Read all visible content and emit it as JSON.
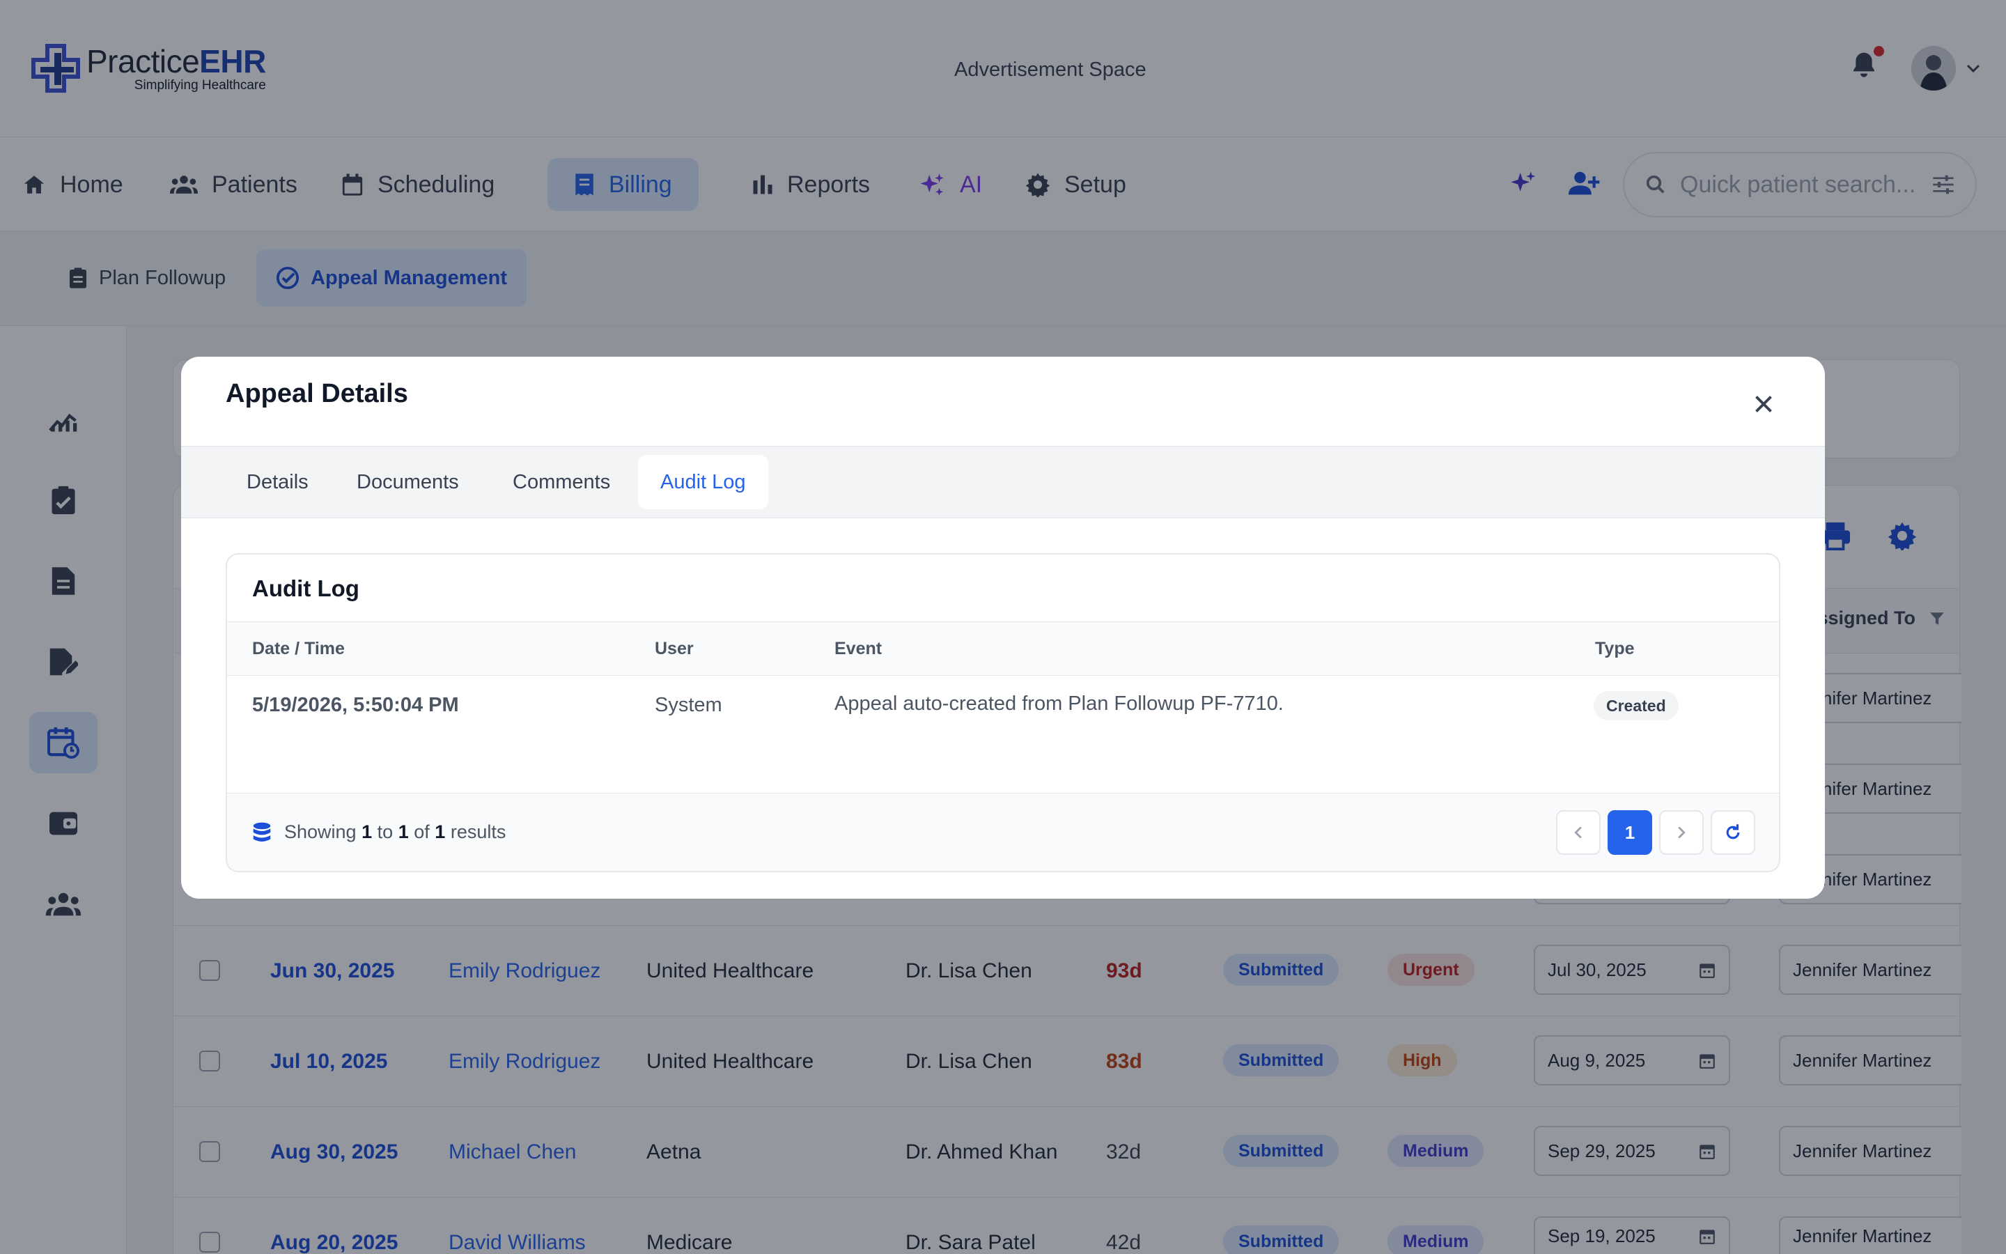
{
  "brand": {
    "name_prefix": "Practice",
    "name_suffix": "EHR",
    "tagline": "Simplifying Healthcare"
  },
  "header": {
    "ad_text": "Advertisement Space"
  },
  "nav": {
    "items": [
      {
        "label": "Home",
        "icon": "home-icon"
      },
      {
        "label": "Patients",
        "icon": "users-icon"
      },
      {
        "label": "Scheduling",
        "icon": "calendar-icon"
      },
      {
        "label": "Billing",
        "icon": "billing-icon",
        "active": true
      },
      {
        "label": "Reports",
        "icon": "bar-chart-icon"
      },
      {
        "label": "AI",
        "icon": "sparkles-icon"
      },
      {
        "label": "Setup",
        "icon": "gear-icon"
      }
    ],
    "search_placeholder": "Quick patient search..."
  },
  "subnav": {
    "items": [
      {
        "label": "Plan Followup",
        "icon": "clipboard-icon"
      },
      {
        "label": "Appeal Management",
        "icon": "check-circle-icon",
        "active": true
      }
    ]
  },
  "table_bg": {
    "assigned_header": "Assigned To",
    "partial_rows_assigned": [
      "Jennifer Martinez",
      "Jennifer Martinez",
      "Jennifer Martinez"
    ],
    "rows": [
      {
        "date": "Jun 30, 2025",
        "patient": "Emily Rodriguez",
        "payer": "United Healthcare",
        "provider": "Dr. Lisa Chen",
        "days": "93d",
        "status": "Submitted",
        "priority": "Urgent",
        "due": "Jul 30, 2025",
        "assigned": "Jennifer Martinez"
      },
      {
        "date": "Jul 10, 2025",
        "patient": "Emily Rodriguez",
        "payer": "United Healthcare",
        "provider": "Dr. Lisa Chen",
        "days": "83d",
        "status": "Submitted",
        "priority": "High",
        "due": "Aug 9, 2025",
        "assigned": "Jennifer Martinez"
      },
      {
        "date": "Aug 30, 2025",
        "patient": "Michael Chen",
        "payer": "Aetna",
        "provider": "Dr. Ahmed Khan",
        "days": "32d",
        "status": "Submitted",
        "priority": "Medium",
        "due": "Sep 29, 2025",
        "assigned": "Jennifer Martinez"
      },
      {
        "date": "Aug 20, 2025",
        "patient": "David Williams",
        "payer": "Medicare",
        "provider": "Dr. Sara Patel",
        "days": "42d",
        "status": "Submitted",
        "priority": "Medium",
        "due": "Sep 19, 2025",
        "assigned": "Jennifer Martinez"
      }
    ]
  },
  "modal": {
    "title": "Appeal Details",
    "tabs": [
      "Details",
      "Documents",
      "Comments",
      "Audit Log"
    ],
    "active_tab": "Audit Log",
    "audit": {
      "title": "Audit Log",
      "columns": [
        "Date / Time",
        "User",
        "Event",
        "Type"
      ],
      "rows": [
        {
          "datetime": "5/19/2026, 5:50:04 PM",
          "user": "System",
          "event": "Appeal auto-created from Plan Followup PF-7710.",
          "type": "Created"
        }
      ],
      "footer": {
        "prefix": "Showing",
        "from": "1",
        "to_word": "to",
        "to": "1",
        "of_word": "of",
        "total": "1",
        "suffix": "results"
      },
      "current_page": "1"
    }
  },
  "colors": {
    "accent": "#2563eb",
    "brand": "#1e40af",
    "ai": "#7c3aed",
    "urgent": "#b91c1c",
    "high": "#c2410c"
  }
}
